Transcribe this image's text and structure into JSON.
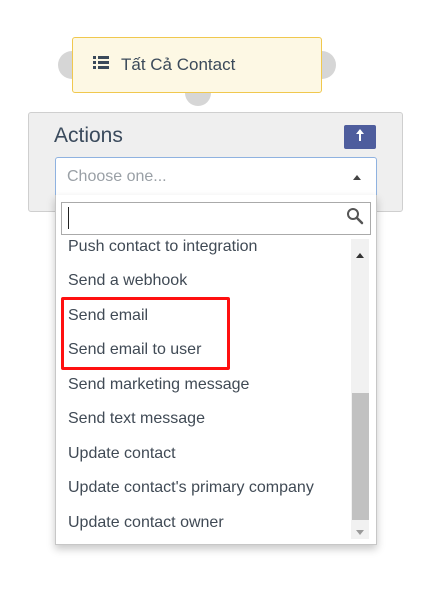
{
  "node": {
    "title": "Tất Cả Contact",
    "icon": "list-icon"
  },
  "actions": {
    "title": "Actions",
    "up_icon": "arrow-up-icon",
    "select_placeholder": "Choose one...",
    "search_value": "",
    "options": [
      "Push contact to integration",
      "Send a webhook",
      "Send email",
      "Send email to user",
      "Send marketing message",
      "Send text message",
      "Update contact",
      "Update contact's primary company",
      "Update contact owner"
    ],
    "highlighted_options": [
      "Send email",
      "Send email to user"
    ]
  },
  "colors": {
    "node_border": "#f0c84e",
    "node_bg": "#fdf8e4",
    "button_bg": "#4e5d9d",
    "highlight": "#ff1010",
    "select_focus_border": "#8fb2e0"
  }
}
